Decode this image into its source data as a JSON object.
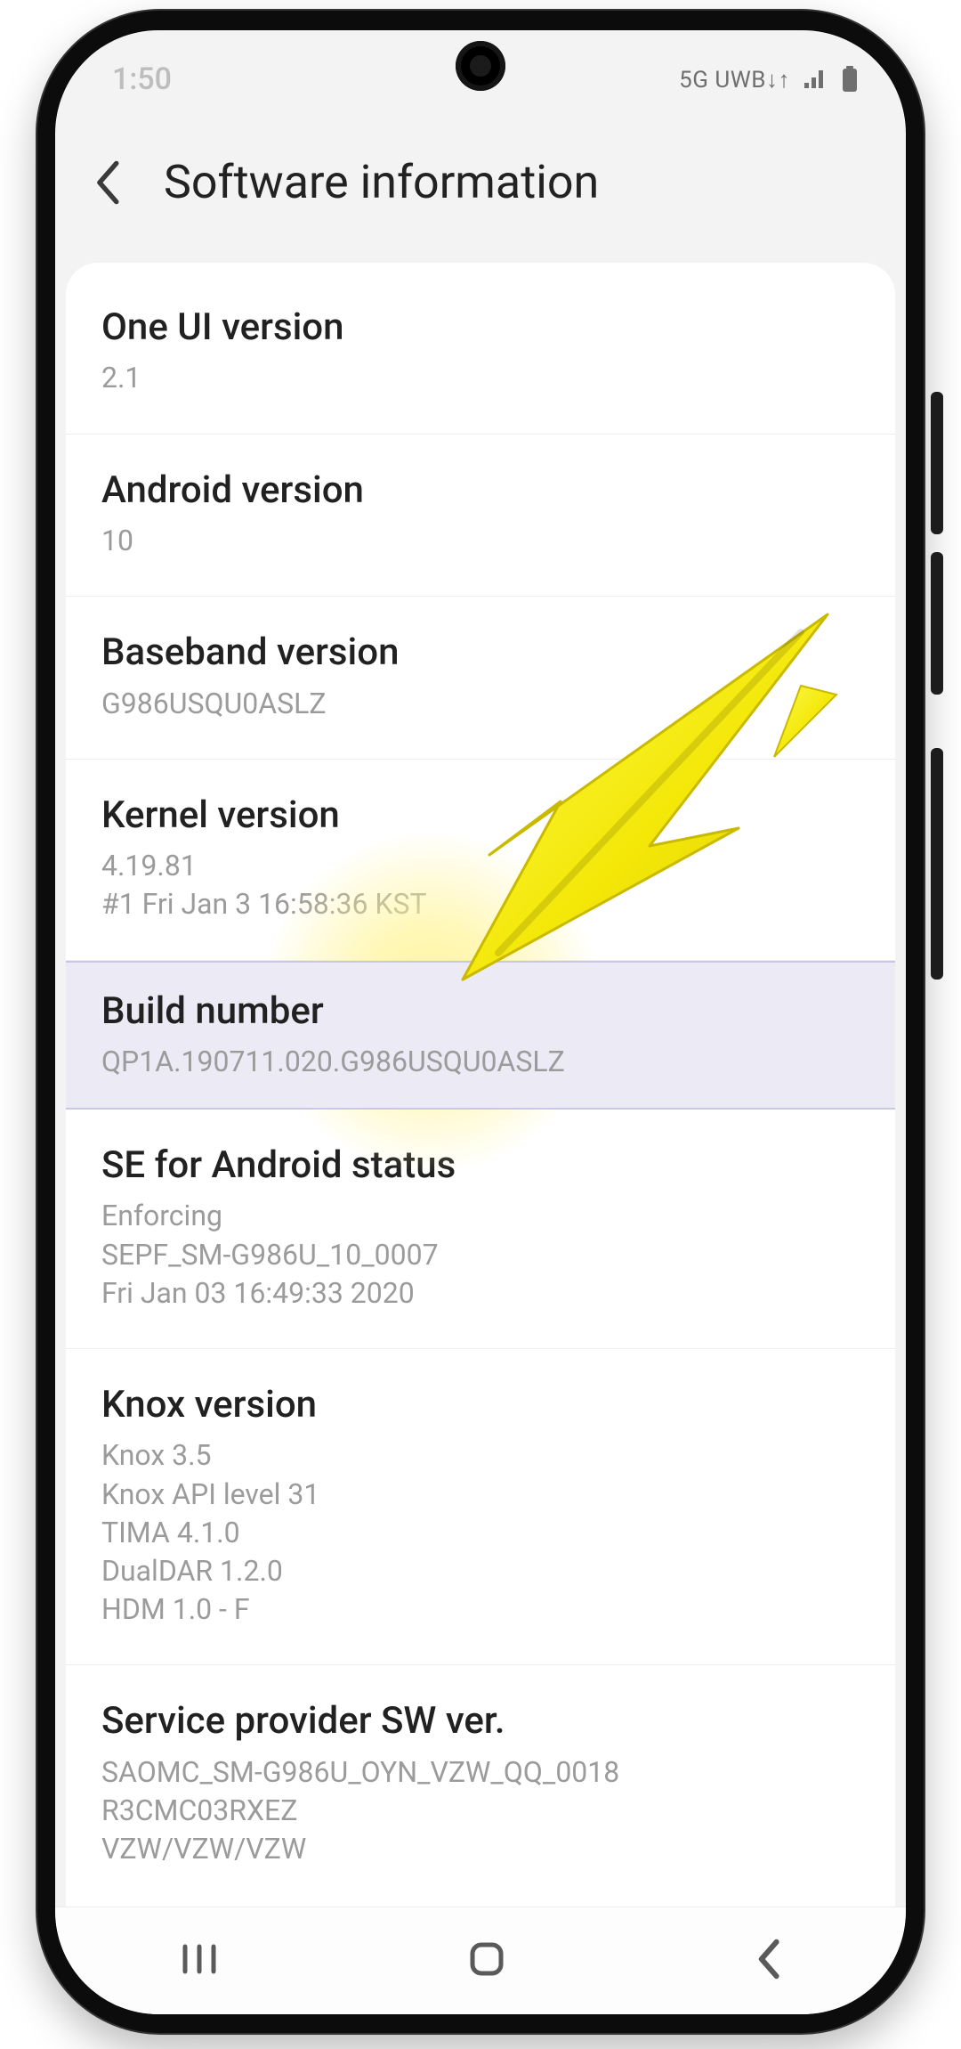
{
  "statusbar": {
    "time": "1:50",
    "network_text": "5G UWB↓↑"
  },
  "appbar": {
    "title": "Software information"
  },
  "rows": {
    "one_ui": {
      "title": "One UI version",
      "value": "2.1"
    },
    "android": {
      "title": "Android version",
      "value": "10"
    },
    "baseband": {
      "title": "Baseband version",
      "value": "G986USQU0ASLZ"
    },
    "kernel": {
      "title": "Kernel version",
      "value": "4.19.81\n#1 Fri Jan 3 16:58:36 KST"
    },
    "build": {
      "title": "Build number",
      "value": "QP1A.190711.020.G986USQU0ASLZ"
    },
    "se_android": {
      "title": "SE for Android status",
      "value": "Enforcing\nSEPF_SM-G986U_10_0007\nFri Jan 03 16:49:33 2020"
    },
    "knox": {
      "title": "Knox version",
      "value": "Knox 3.5\nKnox API level 31\nTIMA 4.1.0\nDualDAR 1.2.0\nHDM 1.0 - F"
    },
    "sp_sw": {
      "title": "Service provider SW ver.",
      "value": "SAOMC_SM-G986U_OYN_VZW_QQ_0018\nR3CMC03RXEZ\nVZW/VZW/VZW"
    }
  },
  "annotation": {
    "target": "build-number-row"
  }
}
